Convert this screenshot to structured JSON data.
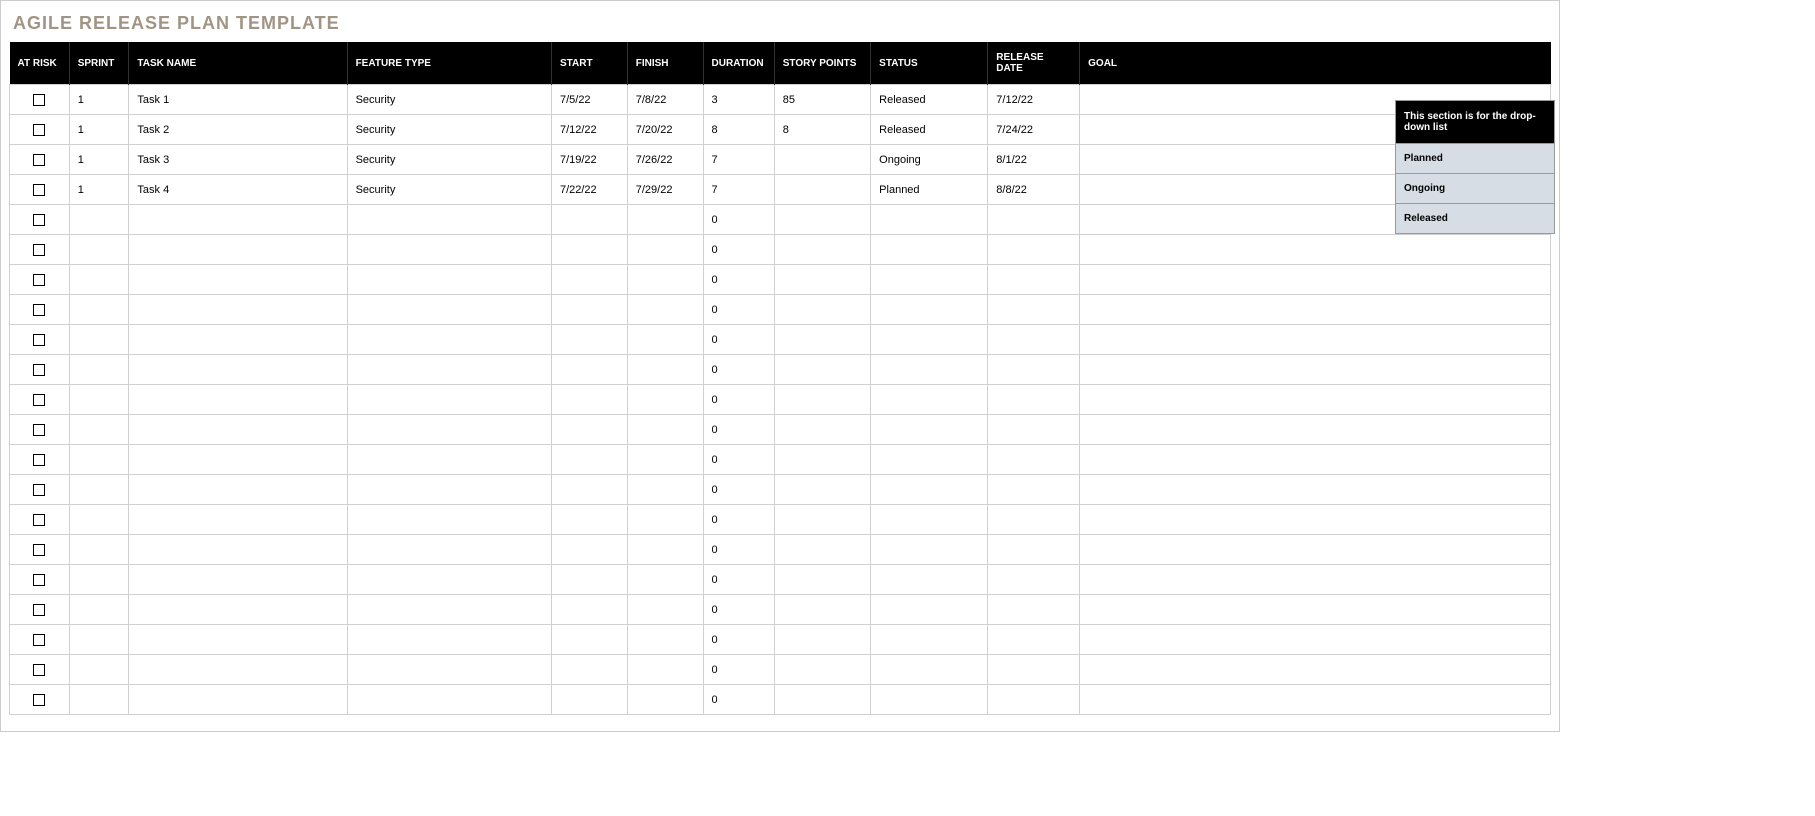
{
  "title": "AGILE RELEASE PLAN TEMPLATE",
  "columns": [
    "AT RISK",
    "SPRINT",
    "TASK NAME",
    "FEATURE TYPE",
    "START",
    "FINISH",
    "DURATION",
    "STORY POINTS",
    "STATUS",
    "RELEASE DATE",
    "GOAL"
  ],
  "rows": [
    {
      "sprint": "1",
      "task": "Task 1",
      "feature": "Security",
      "start": "7/5/22",
      "finish": "7/8/22",
      "duration": "3",
      "story": "85",
      "status": "Released",
      "release": "7/12/22",
      "goal": ""
    },
    {
      "sprint": "1",
      "task": "Task 2",
      "feature": "Security",
      "start": "7/12/22",
      "finish": "7/20/22",
      "duration": "8",
      "story": "8",
      "status": "Released",
      "release": "7/24/22",
      "goal": ""
    },
    {
      "sprint": "1",
      "task": "Task 3",
      "feature": "Security",
      "start": "7/19/22",
      "finish": "7/26/22",
      "duration": "7",
      "story": "",
      "status": "Ongoing",
      "release": "8/1/22",
      "goal": ""
    },
    {
      "sprint": "1",
      "task": "Task 4",
      "feature": "Security",
      "start": "7/22/22",
      "finish": "7/29/22",
      "duration": "7",
      "story": "",
      "status": "Planned",
      "release": "8/8/22",
      "goal": ""
    },
    {
      "sprint": "",
      "task": "",
      "feature": "",
      "start": "",
      "finish": "",
      "duration": "0",
      "story": "",
      "status": "",
      "release": "",
      "goal": ""
    },
    {
      "sprint": "",
      "task": "",
      "feature": "",
      "start": "",
      "finish": "",
      "duration": "0",
      "story": "",
      "status": "",
      "release": "",
      "goal": ""
    },
    {
      "sprint": "",
      "task": "",
      "feature": "",
      "start": "",
      "finish": "",
      "duration": "0",
      "story": "",
      "status": "",
      "release": "",
      "goal": ""
    },
    {
      "sprint": "",
      "task": "",
      "feature": "",
      "start": "",
      "finish": "",
      "duration": "0",
      "story": "",
      "status": "",
      "release": "",
      "goal": ""
    },
    {
      "sprint": "",
      "task": "",
      "feature": "",
      "start": "",
      "finish": "",
      "duration": "0",
      "story": "",
      "status": "",
      "release": "",
      "goal": ""
    },
    {
      "sprint": "",
      "task": "",
      "feature": "",
      "start": "",
      "finish": "",
      "duration": "0",
      "story": "",
      "status": "",
      "release": "",
      "goal": ""
    },
    {
      "sprint": "",
      "task": "",
      "feature": "",
      "start": "",
      "finish": "",
      "duration": "0",
      "story": "",
      "status": "",
      "release": "",
      "goal": ""
    },
    {
      "sprint": "",
      "task": "",
      "feature": "",
      "start": "",
      "finish": "",
      "duration": "0",
      "story": "",
      "status": "",
      "release": "",
      "goal": ""
    },
    {
      "sprint": "",
      "task": "",
      "feature": "",
      "start": "",
      "finish": "",
      "duration": "0",
      "story": "",
      "status": "",
      "release": "",
      "goal": ""
    },
    {
      "sprint": "",
      "task": "",
      "feature": "",
      "start": "",
      "finish": "",
      "duration": "0",
      "story": "",
      "status": "",
      "release": "",
      "goal": ""
    },
    {
      "sprint": "",
      "task": "",
      "feature": "",
      "start": "",
      "finish": "",
      "duration": "0",
      "story": "",
      "status": "",
      "release": "",
      "goal": ""
    },
    {
      "sprint": "",
      "task": "",
      "feature": "",
      "start": "",
      "finish": "",
      "duration": "0",
      "story": "",
      "status": "",
      "release": "",
      "goal": ""
    },
    {
      "sprint": "",
      "task": "",
      "feature": "",
      "start": "",
      "finish": "",
      "duration": "0",
      "story": "",
      "status": "",
      "release": "",
      "goal": ""
    },
    {
      "sprint": "",
      "task": "",
      "feature": "",
      "start": "",
      "finish": "",
      "duration": "0",
      "story": "",
      "status": "",
      "release": "",
      "goal": ""
    },
    {
      "sprint": "",
      "task": "",
      "feature": "",
      "start": "",
      "finish": "",
      "duration": "0",
      "story": "",
      "status": "",
      "release": "",
      "goal": ""
    },
    {
      "sprint": "",
      "task": "",
      "feature": "",
      "start": "",
      "finish": "",
      "duration": "0",
      "story": "",
      "status": "",
      "release": "",
      "goal": ""
    },
    {
      "sprint": "",
      "task": "",
      "feature": "",
      "start": "",
      "finish": "",
      "duration": "0",
      "story": "",
      "status": "",
      "release": "",
      "goal": ""
    }
  ],
  "dropdown": {
    "header": "This section is for the drop-down list",
    "items": [
      "Planned",
      "Ongoing",
      "Released"
    ]
  }
}
